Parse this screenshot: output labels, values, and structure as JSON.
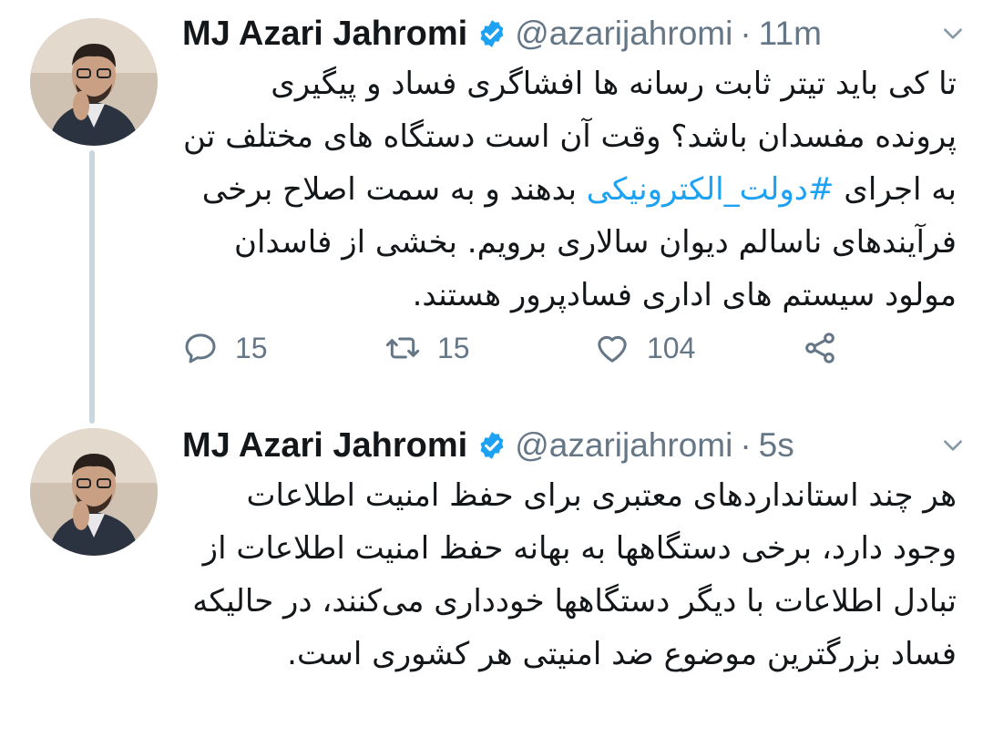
{
  "colors": {
    "accent": "#1da1f2",
    "text": "#14171a",
    "muted": "#657786",
    "thread_line": "#ccd6dd"
  },
  "tweets": [
    {
      "author_name": "MJ Azari Jahromi",
      "handle": "@azarijahromi",
      "separator": "·",
      "time": "11m",
      "verified_icon": "verified-badge-icon",
      "text_before_hashtag": "تا کی باید تیتر ثابت رسانه ها افشاگری فساد و پیگیری پرونده مفسدان باشد؟ وقت آن است دستگاه های مختلف تن به اجرای ",
      "hashtag": "#دولت_الکترونیکی",
      "text_after_hashtag": " بدهند و به سمت اصلاح برخی فرآیندهای ناسالم دیوان سالاری برویم. بخشی از فاسدان مولود سیستم های اداری فسادپرور هستند.",
      "actions": {
        "replies": "15",
        "retweets": "15",
        "likes": "104"
      }
    },
    {
      "author_name": "MJ Azari Jahromi",
      "handle": "@azarijahromi",
      "separator": "·",
      "time": "5s",
      "verified_icon": "verified-badge-icon",
      "text": "هر چند استانداردهای معتبری برای حفظ امنیت اطلاعات وجود دارد، برخی دستگاهها به بهانه حفظ امنیت اطلاعات از تبادل اطلاعات با دیگر دستگاهها خودداری می‌کنند، در حالیکه فساد بزرگترین موضوع ضد امنیتی هر کشوری است."
    }
  ]
}
